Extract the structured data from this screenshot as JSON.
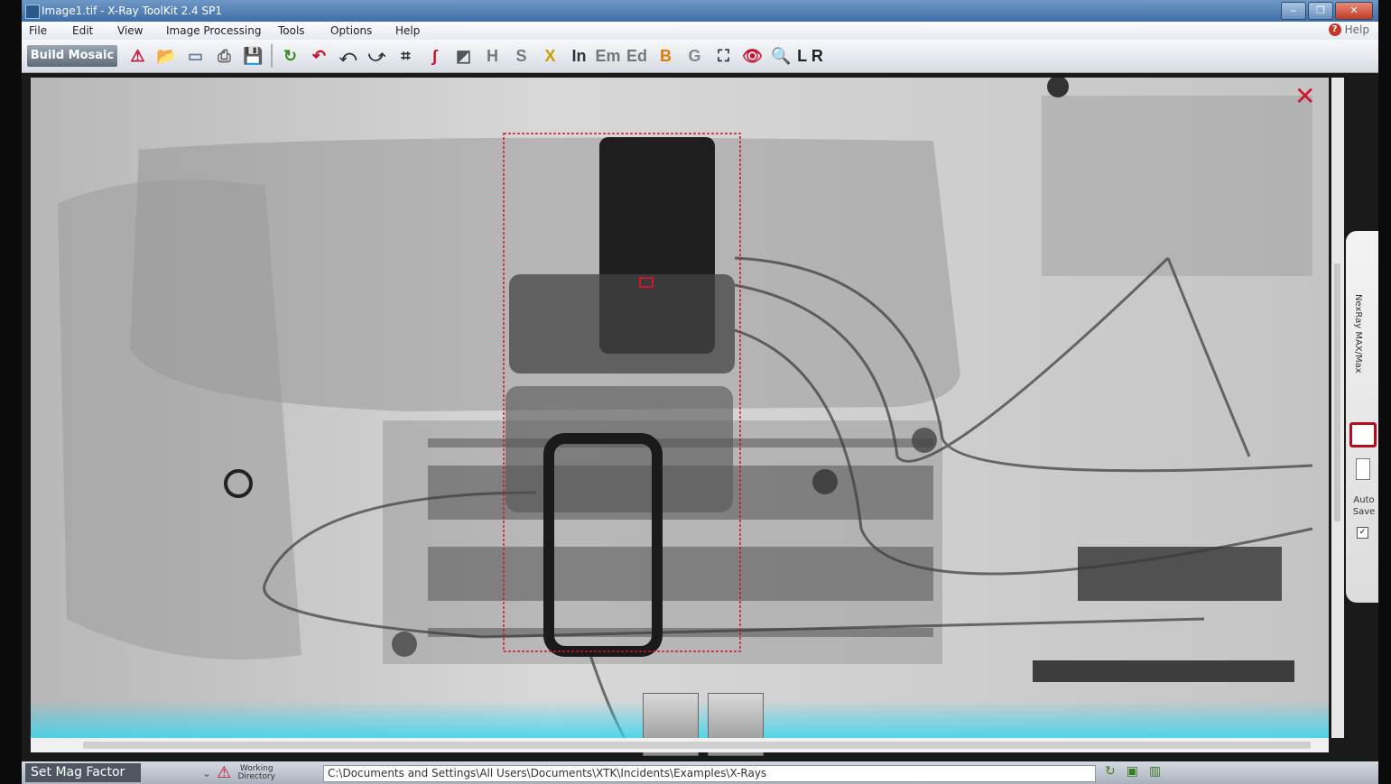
{
  "window": {
    "title": "Image1.tif  -  X-Ray ToolKit 2.4 SP1"
  },
  "menu": {
    "items": [
      "File",
      "Edit",
      "View",
      "Image Processing",
      "Tools",
      "Options",
      "Help"
    ],
    "help_label": "Help"
  },
  "toolbar": {
    "build_mosaic": "Build Mosaic",
    "tools": [
      {
        "name": "warning-icon",
        "glyph": "⚠",
        "color": "#c8102e"
      },
      {
        "name": "open-folder-icon",
        "glyph": "📂",
        "color": "#5b7d3a"
      },
      {
        "name": "scanner-icon",
        "glyph": "▭",
        "color": "#6b7f99"
      },
      {
        "name": "print-icon",
        "glyph": "⎙",
        "color": "#666666"
      },
      {
        "name": "save-icon",
        "glyph": "💾",
        "color": "#555555"
      },
      {
        "name": "separator",
        "glyph": "",
        "color": ""
      },
      {
        "name": "refresh-icon",
        "glyph": "↻",
        "color": "#3a8a2a"
      },
      {
        "name": "undo-icon",
        "glyph": "↶",
        "color": "#c8102e"
      },
      {
        "name": "rotate-left-icon",
        "glyph": "⤺",
        "color": "#333333"
      },
      {
        "name": "rotate-right-icon",
        "glyph": "⤻",
        "color": "#333333"
      },
      {
        "name": "crop-icon",
        "glyph": "⌗",
        "color": "#333333"
      },
      {
        "name": "curve-icon",
        "glyph": "∫",
        "color": "#c8102e"
      },
      {
        "name": "histogram-icon",
        "glyph": "◩",
        "color": "#555555"
      },
      {
        "name": "h-tool-icon",
        "glyph": "H",
        "color": "#777777"
      },
      {
        "name": "s-tool-icon",
        "glyph": "S",
        "color": "#777777"
      },
      {
        "name": "x-tool-icon",
        "glyph": "X",
        "color": "#c9a000"
      },
      {
        "name": "in-tool-icon",
        "glyph": "In",
        "color": "#333333"
      },
      {
        "name": "em-tool-icon",
        "glyph": "Em",
        "color": "#777777"
      },
      {
        "name": "ed-tool-icon",
        "glyph": "Ed",
        "color": "#777777"
      },
      {
        "name": "b-tool-icon",
        "glyph": "B",
        "color": "#e07b00"
      },
      {
        "name": "g-tool-icon",
        "glyph": "G",
        "color": "#888888"
      },
      {
        "name": "fit-screen-icon",
        "glyph": "⛶",
        "color": "#333333"
      },
      {
        "name": "view-eye-icon",
        "glyph": "👁",
        "color": "#c8102e"
      },
      {
        "name": "zoom-icon",
        "glyph": "🔍",
        "color": "#555555"
      },
      {
        "name": "lr-tool-icon",
        "glyph": "L R",
        "color": "#222222"
      }
    ]
  },
  "side_panel": {
    "title": "NexRay MAX/Max",
    "auto_save": "Auto Save",
    "auto_save_checked": "✓"
  },
  "status": {
    "set_mag_factor": "Set Mag Factor",
    "working_directory_label": "Working Directory",
    "path": "C:\\Documents and Settings\\All Users\\Documents\\XTK\\Incidents\\Examples\\X-Rays"
  },
  "colors": {
    "selection": "#d0142b",
    "accent": "#3f6fa6",
    "bottom_glow": "#35d6ef"
  }
}
